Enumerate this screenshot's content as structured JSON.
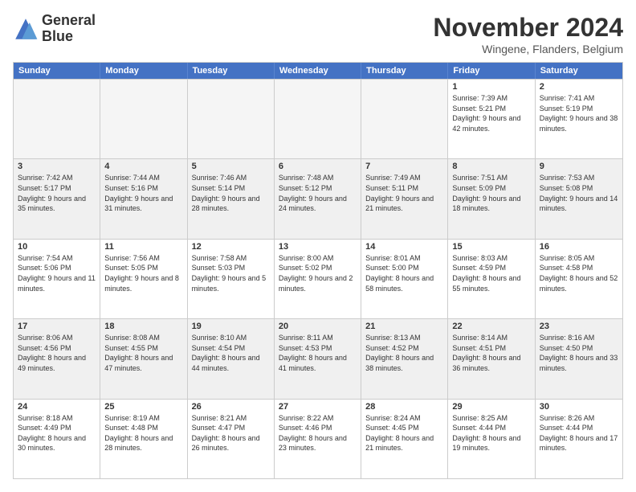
{
  "header": {
    "logo_line1": "General",
    "logo_line2": "Blue",
    "main_title": "November 2024",
    "subtitle": "Wingene, Flanders, Belgium"
  },
  "days_of_week": [
    "Sunday",
    "Monday",
    "Tuesday",
    "Wednesday",
    "Thursday",
    "Friday",
    "Saturday"
  ],
  "weeks": [
    [
      {
        "day": "",
        "empty": true
      },
      {
        "day": "",
        "empty": true
      },
      {
        "day": "",
        "empty": true
      },
      {
        "day": "",
        "empty": true
      },
      {
        "day": "",
        "empty": true
      },
      {
        "day": "1",
        "sunrise": "Sunrise: 7:39 AM",
        "sunset": "Sunset: 5:21 PM",
        "daylight": "Daylight: 9 hours and 42 minutes."
      },
      {
        "day": "2",
        "sunrise": "Sunrise: 7:41 AM",
        "sunset": "Sunset: 5:19 PM",
        "daylight": "Daylight: 9 hours and 38 minutes."
      }
    ],
    [
      {
        "day": "3",
        "sunrise": "Sunrise: 7:42 AM",
        "sunset": "Sunset: 5:17 PM",
        "daylight": "Daylight: 9 hours and 35 minutes."
      },
      {
        "day": "4",
        "sunrise": "Sunrise: 7:44 AM",
        "sunset": "Sunset: 5:16 PM",
        "daylight": "Daylight: 9 hours and 31 minutes."
      },
      {
        "day": "5",
        "sunrise": "Sunrise: 7:46 AM",
        "sunset": "Sunset: 5:14 PM",
        "daylight": "Daylight: 9 hours and 28 minutes."
      },
      {
        "day": "6",
        "sunrise": "Sunrise: 7:48 AM",
        "sunset": "Sunset: 5:12 PM",
        "daylight": "Daylight: 9 hours and 24 minutes."
      },
      {
        "day": "7",
        "sunrise": "Sunrise: 7:49 AM",
        "sunset": "Sunset: 5:11 PM",
        "daylight": "Daylight: 9 hours and 21 minutes."
      },
      {
        "day": "8",
        "sunrise": "Sunrise: 7:51 AM",
        "sunset": "Sunset: 5:09 PM",
        "daylight": "Daylight: 9 hours and 18 minutes."
      },
      {
        "day": "9",
        "sunrise": "Sunrise: 7:53 AM",
        "sunset": "Sunset: 5:08 PM",
        "daylight": "Daylight: 9 hours and 14 minutes."
      }
    ],
    [
      {
        "day": "10",
        "sunrise": "Sunrise: 7:54 AM",
        "sunset": "Sunset: 5:06 PM",
        "daylight": "Daylight: 9 hours and 11 minutes."
      },
      {
        "day": "11",
        "sunrise": "Sunrise: 7:56 AM",
        "sunset": "Sunset: 5:05 PM",
        "daylight": "Daylight: 9 hours and 8 minutes."
      },
      {
        "day": "12",
        "sunrise": "Sunrise: 7:58 AM",
        "sunset": "Sunset: 5:03 PM",
        "daylight": "Daylight: 9 hours and 5 minutes."
      },
      {
        "day": "13",
        "sunrise": "Sunrise: 8:00 AM",
        "sunset": "Sunset: 5:02 PM",
        "daylight": "Daylight: 9 hours and 2 minutes."
      },
      {
        "day": "14",
        "sunrise": "Sunrise: 8:01 AM",
        "sunset": "Sunset: 5:00 PM",
        "daylight": "Daylight: 8 hours and 58 minutes."
      },
      {
        "day": "15",
        "sunrise": "Sunrise: 8:03 AM",
        "sunset": "Sunset: 4:59 PM",
        "daylight": "Daylight: 8 hours and 55 minutes."
      },
      {
        "day": "16",
        "sunrise": "Sunrise: 8:05 AM",
        "sunset": "Sunset: 4:58 PM",
        "daylight": "Daylight: 8 hours and 52 minutes."
      }
    ],
    [
      {
        "day": "17",
        "sunrise": "Sunrise: 8:06 AM",
        "sunset": "Sunset: 4:56 PM",
        "daylight": "Daylight: 8 hours and 49 minutes."
      },
      {
        "day": "18",
        "sunrise": "Sunrise: 8:08 AM",
        "sunset": "Sunset: 4:55 PM",
        "daylight": "Daylight: 8 hours and 47 minutes."
      },
      {
        "day": "19",
        "sunrise": "Sunrise: 8:10 AM",
        "sunset": "Sunset: 4:54 PM",
        "daylight": "Daylight: 8 hours and 44 minutes."
      },
      {
        "day": "20",
        "sunrise": "Sunrise: 8:11 AM",
        "sunset": "Sunset: 4:53 PM",
        "daylight": "Daylight: 8 hours and 41 minutes."
      },
      {
        "day": "21",
        "sunrise": "Sunrise: 8:13 AM",
        "sunset": "Sunset: 4:52 PM",
        "daylight": "Daylight: 8 hours and 38 minutes."
      },
      {
        "day": "22",
        "sunrise": "Sunrise: 8:14 AM",
        "sunset": "Sunset: 4:51 PM",
        "daylight": "Daylight: 8 hours and 36 minutes."
      },
      {
        "day": "23",
        "sunrise": "Sunrise: 8:16 AM",
        "sunset": "Sunset: 4:50 PM",
        "daylight": "Daylight: 8 hours and 33 minutes."
      }
    ],
    [
      {
        "day": "24",
        "sunrise": "Sunrise: 8:18 AM",
        "sunset": "Sunset: 4:49 PM",
        "daylight": "Daylight: 8 hours and 30 minutes."
      },
      {
        "day": "25",
        "sunrise": "Sunrise: 8:19 AM",
        "sunset": "Sunset: 4:48 PM",
        "daylight": "Daylight: 8 hours and 28 minutes."
      },
      {
        "day": "26",
        "sunrise": "Sunrise: 8:21 AM",
        "sunset": "Sunset: 4:47 PM",
        "daylight": "Daylight: 8 hours and 26 minutes."
      },
      {
        "day": "27",
        "sunrise": "Sunrise: 8:22 AM",
        "sunset": "Sunset: 4:46 PM",
        "daylight": "Daylight: 8 hours and 23 minutes."
      },
      {
        "day": "28",
        "sunrise": "Sunrise: 8:24 AM",
        "sunset": "Sunset: 4:45 PM",
        "daylight": "Daylight: 8 hours and 21 minutes."
      },
      {
        "day": "29",
        "sunrise": "Sunrise: 8:25 AM",
        "sunset": "Sunset: 4:44 PM",
        "daylight": "Daylight: 8 hours and 19 minutes."
      },
      {
        "day": "30",
        "sunrise": "Sunrise: 8:26 AM",
        "sunset": "Sunset: 4:44 PM",
        "daylight": "Daylight: 8 hours and 17 minutes."
      }
    ]
  ]
}
